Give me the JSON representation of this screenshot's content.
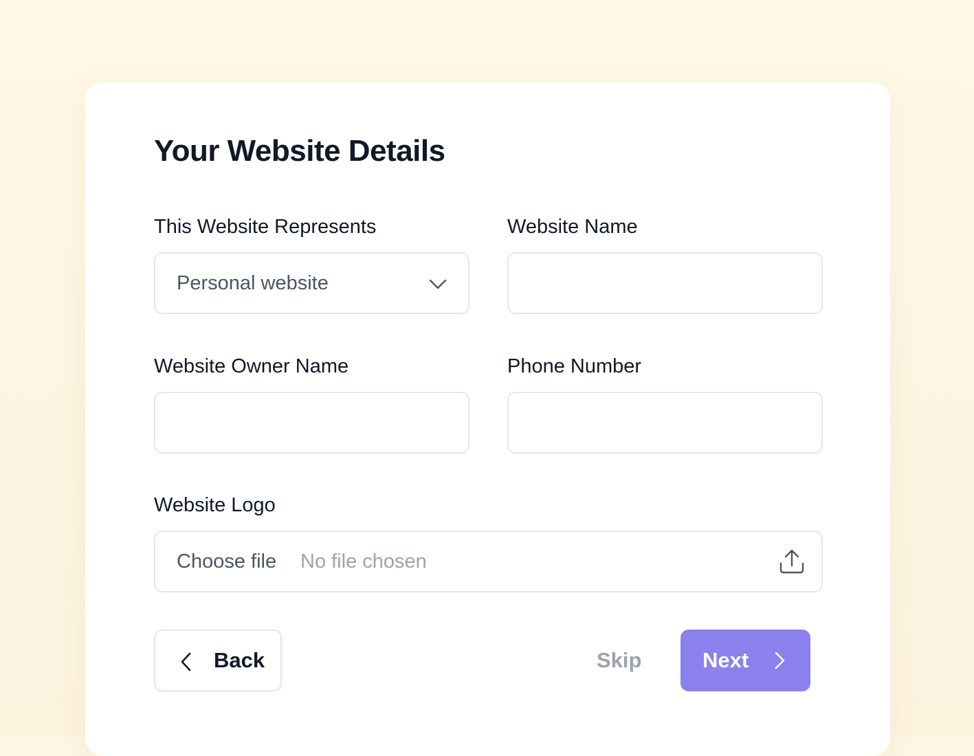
{
  "form": {
    "title": "Your Website Details",
    "represents": {
      "label": "This Website Represents",
      "selected": "Personal website"
    },
    "website_name": {
      "label": "Website Name",
      "value": ""
    },
    "owner_name": {
      "label": "Website Owner Name",
      "value": ""
    },
    "phone": {
      "label": "Phone Number",
      "value": ""
    },
    "logo": {
      "label": "Website Logo",
      "button_label": "Choose file",
      "status": "No file chosen"
    }
  },
  "actions": {
    "back_label": "Back",
    "skip_label": "Skip",
    "next_label": "Next"
  },
  "colors": {
    "background": "#fdf6e3",
    "card": "#ffffff",
    "accent": "#8b80ec",
    "border": "#e5e7eb",
    "muted_text": "#9ca3af",
    "heading_text": "#111827"
  },
  "icons": {
    "select_chevron": "chevron-down-icon",
    "upload": "upload-icon",
    "back": "chevron-left-icon",
    "next": "chevron-right-icon"
  }
}
